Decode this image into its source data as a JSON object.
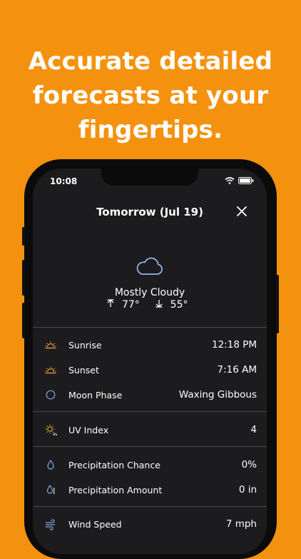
{
  "headline": {
    "line1": "Accurate detailed",
    "line2": "forecasts at your",
    "line3": "fingertips."
  },
  "status_bar": {
    "time": "10:08"
  },
  "header": {
    "title": "Tomorrow (Jul 19)"
  },
  "summary": {
    "condition": "Mostly Cloudy",
    "high": "77°",
    "low": "55°"
  },
  "details": {
    "sunrise": {
      "label": "Sunrise",
      "value": "12:18 PM",
      "icon": "sunrise-icon"
    },
    "sunset": {
      "label": "Sunset",
      "value": "7:16 AM",
      "icon": "sunset-icon"
    },
    "moon": {
      "label": "Moon Phase",
      "value": "Waxing Gibbous",
      "icon": "moon-icon"
    },
    "uv": {
      "label": "UV Index",
      "value": "4",
      "icon": "uv-icon"
    },
    "precip_chance": {
      "label": "Precipitation Chance",
      "value": "0%",
      "icon": "droplet-icon"
    },
    "precip_amount": {
      "label": "Precipitation Amount",
      "value": "0 in",
      "icon": "rain-gauge-icon"
    },
    "wind": {
      "label": "Wind Speed",
      "value": "7 mph",
      "icon": "wind-icon"
    }
  },
  "colors": {
    "background": "#F4920F",
    "screen": "#1C1C1E",
    "sun_icon": "#E8A33A",
    "cloud_icon": "#8FB3E8",
    "moon_icon": "#7FA8E0"
  }
}
